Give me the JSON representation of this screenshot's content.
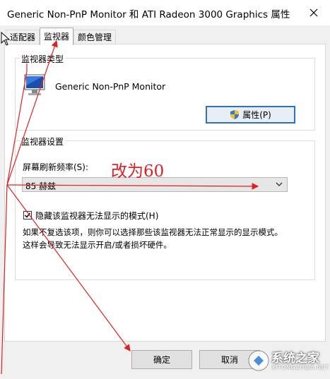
{
  "window": {
    "title": "Generic Non-PnP Monitor 和 ATI Radeon 3000 Graphics 属性"
  },
  "tabs": [
    {
      "label": "适配器",
      "active": false
    },
    {
      "label": "监视器",
      "active": true
    },
    {
      "label": "颜色管理",
      "active": false
    }
  ],
  "monitor_type": {
    "group_label": "监视器类型",
    "monitor_name": "Generic Non-PnP Monitor",
    "properties_button": "属性(P)"
  },
  "monitor_settings": {
    "group_label": "监视器设置",
    "refresh_label": "屏幕刷新频率(S):",
    "refresh_value": "85 赫兹",
    "hide_modes_label": "隐藏该监视器无法显示的模式(H)",
    "hide_modes_checked": true,
    "description_lines": [
      "如果不复选该项，则你可以选择那些该监视器无法正常显示的显示模式。",
      "这样会导致无法显示开启/或者损坏硬件。"
    ]
  },
  "buttons": {
    "ok": "确定",
    "cancel": "取消"
  },
  "annotation": {
    "text": "改为60",
    "color": "#e02020"
  },
  "watermark": {
    "text": "系统之家",
    "url": "XITONGZHIJIA.NET"
  },
  "colors": {
    "primary_button_border": "#2f72c0",
    "annotation": "#e02020"
  }
}
